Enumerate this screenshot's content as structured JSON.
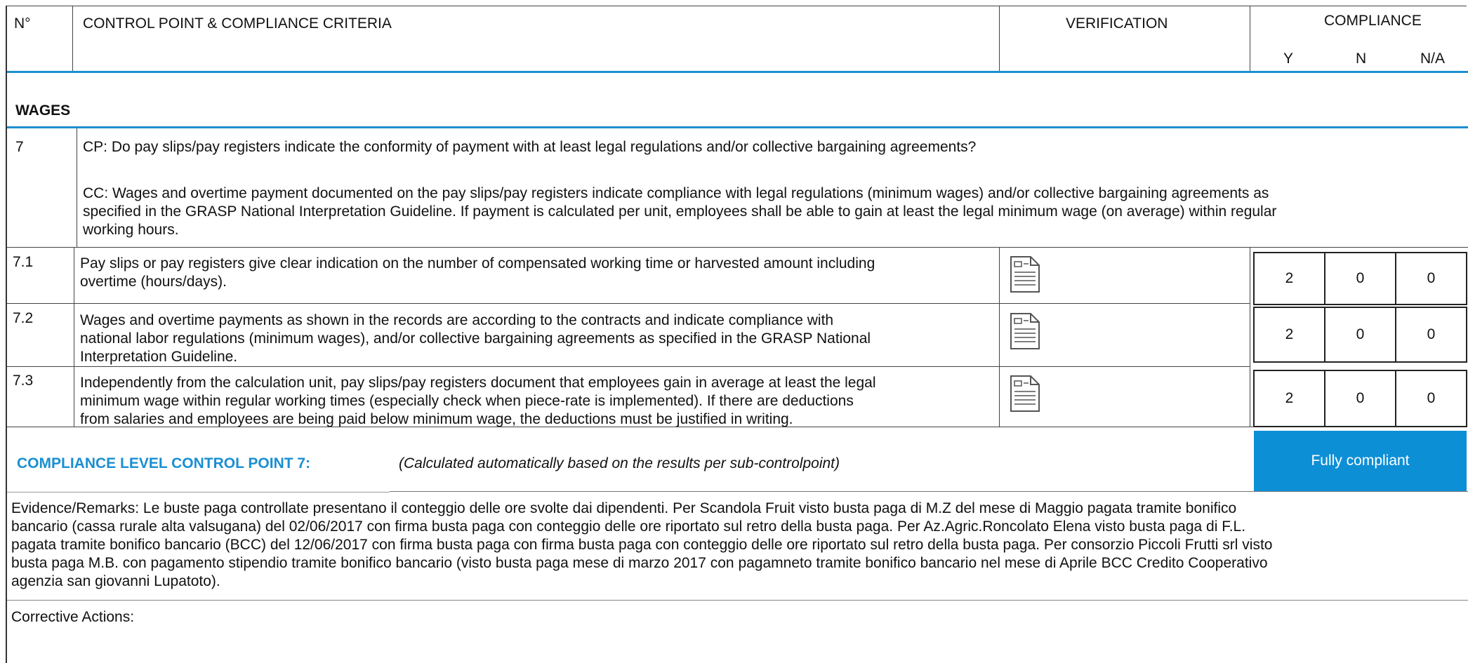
{
  "header": {
    "no": "N°",
    "control_point": "CONTROL POINT & COMPLIANCE CRITERIA",
    "verification": "VERIFICATION",
    "compliance": "COMPLIANCE",
    "y": "Y",
    "n": "N",
    "na": "N/A"
  },
  "section": {
    "title": "WAGES"
  },
  "cp": {
    "number": "7",
    "question": "CP: Do pay slips/pay registers indicate the conformity of payment with at least legal regulations and/or collective bargaining agreements?",
    "criteria_lines": [
      "CC: Wages and overtime payment documented on the pay slips/pay registers indicate compliance with legal regulations (minimum wages) and/or collective bargaining agreements as",
      "specified in the GRASP National Interpretation Guideline. If payment is calculated per unit, employees shall be able to gain at least the legal minimum wage (on average) within regular",
      "working hours."
    ]
  },
  "rows": [
    {
      "number": "7.1",
      "lines": [
        "Pay slips or pay registers give clear indication on the number of compensated working time or harvested amount including",
        "overtime (hours/days)."
      ],
      "verification_icon": "document-icon",
      "y": "2",
      "n": "0",
      "na": "0"
    },
    {
      "number": "7.2",
      "lines": [
        "Wages and overtime payments as shown in the records are according to the contracts and indicate compliance with",
        "national labor regulations (minimum wages), and/or collective bargaining agreements as specified in the GRASP National",
        "Interpretation Guideline."
      ],
      "verification_icon": "document-icon",
      "y": "2",
      "n": "0",
      "na": "0"
    },
    {
      "number": "7.3",
      "lines": [
        "Independently from the calculation unit, pay slips/pay registers document that employees gain in average at least the legal",
        "minimum wage within regular working times (especially check when piece-rate is implemented). If there are deductions",
        "from salaries and employees are being paid below minimum wage, the deductions must be justified in writing."
      ],
      "verification_icon": "document-icon",
      "y": "2",
      "n": "0",
      "na": "0"
    }
  ],
  "compliance_level": {
    "label": "COMPLIANCE LEVEL CONTROL POINT 7:",
    "note": "(Calculated automatically based on the results per sub-controlpoint)",
    "result": "Fully compliant"
  },
  "evidence_lines": [
    "Evidence/Remarks: Le buste paga controllate presentano il conteggio delle ore svolte dai dipendenti. Per Scandola Fruit visto busta paga di M.Z del mese di Maggio pagata tramite bonifico",
    "bancario (cassa rurale alta valsugana) del 02/06/2017 con firma busta paga con conteggio delle ore riportato sul retro della busta paga. Per Az.Agric.Roncolato Elena visto busta paga di F.L.",
    "pagata tramite bonifico bancario (BCC) del 12/06/2017 con firma busta paga  con firma busta paga con conteggio delle ore riportato sul retro della busta paga. Per consorzio Piccoli Frutti srl visto",
    "busta paga M.B. con pagamento stipendio tramite bonifico bancario (visto busta paga mese di marzo 2017 con pagamneto tramite bonifico bancario nel mese di Aprile BCC Credito Cooperativo",
    "agenzia san giovanni Lupatoto)."
  ],
  "corrective_actions": "Corrective Actions:",
  "colors": {
    "accent": "#1a8fd1",
    "badge_bg": "#0d8fd6"
  }
}
